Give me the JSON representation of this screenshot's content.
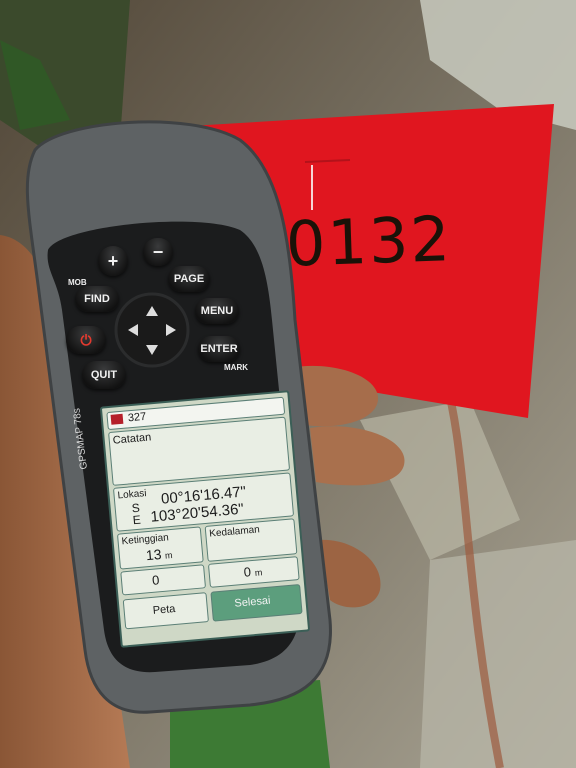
{
  "tag": {
    "number": "0132"
  },
  "device": {
    "brand": "GARMIN",
    "model": "GPSMAP 78s",
    "buttons": {
      "plus": "+",
      "minus": "−",
      "mob": "MOB",
      "find": "FIND",
      "page": "PAGE",
      "menu": "MENU",
      "enter": "ENTER",
      "mark": "MARK",
      "quit": "QUIT"
    }
  },
  "screen": {
    "waypoint": "327",
    "note_label": "Catatan",
    "location_label": "Lokasi",
    "lat_dir": "S",
    "lat": "00°16'16.47\"",
    "lon_dir": "E",
    "lon": "103°20'54.36\"",
    "elevation_label": "Ketinggian",
    "elevation": "13",
    "elevation_unit": "m",
    "depth_label": "Kedalaman",
    "field_left": "0",
    "field_right": "0",
    "field_right_unit": "m",
    "map_button": "Peta",
    "done_button": "Selesai"
  },
  "colors": {
    "tag": "#e0161f",
    "device_body": "#5e6264",
    "screen_bg": "#cfd8c6",
    "done_button": "#5c9e7d"
  }
}
